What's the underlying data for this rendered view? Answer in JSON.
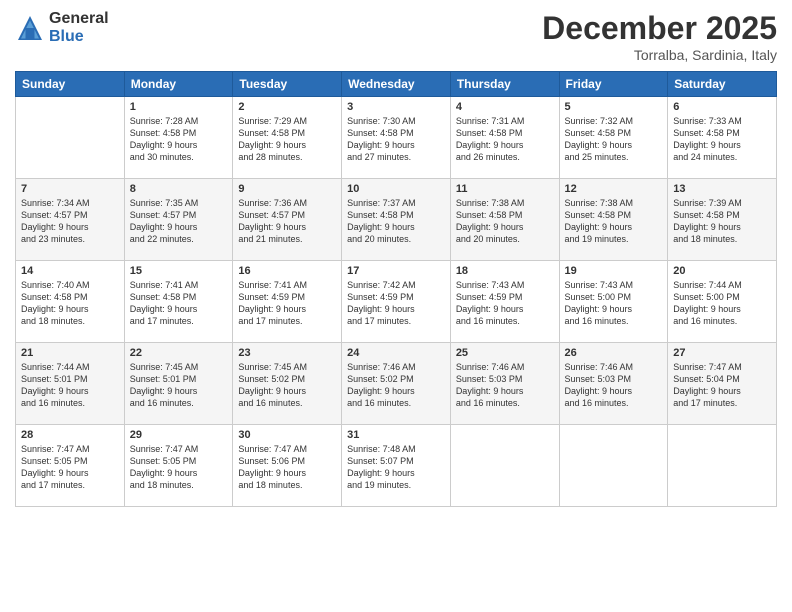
{
  "logo": {
    "general": "General",
    "blue": "Blue"
  },
  "header": {
    "month": "December 2025",
    "location": "Torralba, Sardinia, Italy"
  },
  "weekdays": [
    "Sunday",
    "Monday",
    "Tuesday",
    "Wednesday",
    "Thursday",
    "Friday",
    "Saturday"
  ],
  "weeks": [
    [
      {
        "day": "",
        "info": ""
      },
      {
        "day": "1",
        "info": "Sunrise: 7:28 AM\nSunset: 4:58 PM\nDaylight: 9 hours\nand 30 minutes."
      },
      {
        "day": "2",
        "info": "Sunrise: 7:29 AM\nSunset: 4:58 PM\nDaylight: 9 hours\nand 28 minutes."
      },
      {
        "day": "3",
        "info": "Sunrise: 7:30 AM\nSunset: 4:58 PM\nDaylight: 9 hours\nand 27 minutes."
      },
      {
        "day": "4",
        "info": "Sunrise: 7:31 AM\nSunset: 4:58 PM\nDaylight: 9 hours\nand 26 minutes."
      },
      {
        "day": "5",
        "info": "Sunrise: 7:32 AM\nSunset: 4:58 PM\nDaylight: 9 hours\nand 25 minutes."
      },
      {
        "day": "6",
        "info": "Sunrise: 7:33 AM\nSunset: 4:58 PM\nDaylight: 9 hours\nand 24 minutes."
      }
    ],
    [
      {
        "day": "7",
        "info": "Sunrise: 7:34 AM\nSunset: 4:57 PM\nDaylight: 9 hours\nand 23 minutes."
      },
      {
        "day": "8",
        "info": "Sunrise: 7:35 AM\nSunset: 4:57 PM\nDaylight: 9 hours\nand 22 minutes."
      },
      {
        "day": "9",
        "info": "Sunrise: 7:36 AM\nSunset: 4:57 PM\nDaylight: 9 hours\nand 21 minutes."
      },
      {
        "day": "10",
        "info": "Sunrise: 7:37 AM\nSunset: 4:58 PM\nDaylight: 9 hours\nand 20 minutes."
      },
      {
        "day": "11",
        "info": "Sunrise: 7:38 AM\nSunset: 4:58 PM\nDaylight: 9 hours\nand 20 minutes."
      },
      {
        "day": "12",
        "info": "Sunrise: 7:38 AM\nSunset: 4:58 PM\nDaylight: 9 hours\nand 19 minutes."
      },
      {
        "day": "13",
        "info": "Sunrise: 7:39 AM\nSunset: 4:58 PM\nDaylight: 9 hours\nand 18 minutes."
      }
    ],
    [
      {
        "day": "14",
        "info": "Sunrise: 7:40 AM\nSunset: 4:58 PM\nDaylight: 9 hours\nand 18 minutes."
      },
      {
        "day": "15",
        "info": "Sunrise: 7:41 AM\nSunset: 4:58 PM\nDaylight: 9 hours\nand 17 minutes."
      },
      {
        "day": "16",
        "info": "Sunrise: 7:41 AM\nSunset: 4:59 PM\nDaylight: 9 hours\nand 17 minutes."
      },
      {
        "day": "17",
        "info": "Sunrise: 7:42 AM\nSunset: 4:59 PM\nDaylight: 9 hours\nand 17 minutes."
      },
      {
        "day": "18",
        "info": "Sunrise: 7:43 AM\nSunset: 4:59 PM\nDaylight: 9 hours\nand 16 minutes."
      },
      {
        "day": "19",
        "info": "Sunrise: 7:43 AM\nSunset: 5:00 PM\nDaylight: 9 hours\nand 16 minutes."
      },
      {
        "day": "20",
        "info": "Sunrise: 7:44 AM\nSunset: 5:00 PM\nDaylight: 9 hours\nand 16 minutes."
      }
    ],
    [
      {
        "day": "21",
        "info": "Sunrise: 7:44 AM\nSunset: 5:01 PM\nDaylight: 9 hours\nand 16 minutes."
      },
      {
        "day": "22",
        "info": "Sunrise: 7:45 AM\nSunset: 5:01 PM\nDaylight: 9 hours\nand 16 minutes."
      },
      {
        "day": "23",
        "info": "Sunrise: 7:45 AM\nSunset: 5:02 PM\nDaylight: 9 hours\nand 16 minutes."
      },
      {
        "day": "24",
        "info": "Sunrise: 7:46 AM\nSunset: 5:02 PM\nDaylight: 9 hours\nand 16 minutes."
      },
      {
        "day": "25",
        "info": "Sunrise: 7:46 AM\nSunset: 5:03 PM\nDaylight: 9 hours\nand 16 minutes."
      },
      {
        "day": "26",
        "info": "Sunrise: 7:46 AM\nSunset: 5:03 PM\nDaylight: 9 hours\nand 16 minutes."
      },
      {
        "day": "27",
        "info": "Sunrise: 7:47 AM\nSunset: 5:04 PM\nDaylight: 9 hours\nand 17 minutes."
      }
    ],
    [
      {
        "day": "28",
        "info": "Sunrise: 7:47 AM\nSunset: 5:05 PM\nDaylight: 9 hours\nand 17 minutes."
      },
      {
        "day": "29",
        "info": "Sunrise: 7:47 AM\nSunset: 5:05 PM\nDaylight: 9 hours\nand 18 minutes."
      },
      {
        "day": "30",
        "info": "Sunrise: 7:47 AM\nSunset: 5:06 PM\nDaylight: 9 hours\nand 18 minutes."
      },
      {
        "day": "31",
        "info": "Sunrise: 7:48 AM\nSunset: 5:07 PM\nDaylight: 9 hours\nand 19 minutes."
      },
      {
        "day": "",
        "info": ""
      },
      {
        "day": "",
        "info": ""
      },
      {
        "day": "",
        "info": ""
      }
    ]
  ]
}
